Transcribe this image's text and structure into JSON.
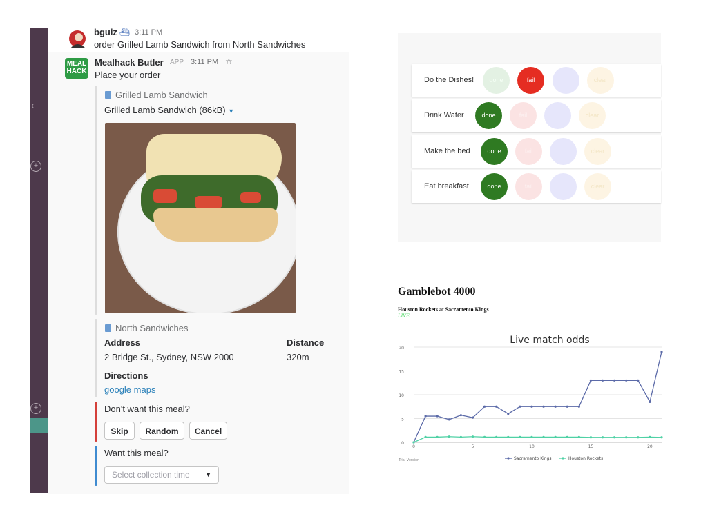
{
  "slack": {
    "user_message": {
      "username": "bguiz",
      "emoji": "⛴",
      "time": "3:11 PM",
      "text": "order Grilled Lamb Sandwich from North Sandwiches"
    },
    "bot_message": {
      "avatar_text_1": "MEAL",
      "avatar_text_2": "HACK",
      "username": "Mealhack Butler",
      "badge": "APP",
      "time": "3:11 PM",
      "text": "Place your order"
    },
    "meal_attachment": {
      "title": "Grilled Lamb Sandwich",
      "file_label": "Grilled Lamb Sandwich (86kB)"
    },
    "shop_attachment": {
      "title": "North Sandwiches",
      "address_label": "Address",
      "address_value": "2 Bridge St., Sydney, NSW 2000",
      "distance_label": "Distance",
      "distance_value": "320m",
      "directions_label": "Directions",
      "directions_link": "google maps"
    },
    "reject_attachment": {
      "question": "Don't want this meal?",
      "buttons": [
        "Skip",
        "Random",
        "Cancel"
      ]
    },
    "accept_attachment": {
      "question": "Want this meal?",
      "select_placeholder": "Select collection time"
    }
  },
  "habits": {
    "button_labels": {
      "done": "done",
      "fail": "fail",
      "skip": "",
      "clear": "clear"
    },
    "rows": [
      {
        "name": "Do the Dishes!",
        "state": "fail"
      },
      {
        "name": "Drink Water",
        "state": "done"
      },
      {
        "name": "Make the bed",
        "state": "done"
      },
      {
        "name": "Eat breakfast",
        "state": "done"
      }
    ]
  },
  "gamblebot": {
    "title": "Gamblebot 4000",
    "match": "Houston Rockets at Sacramento Kings",
    "status": "LIVE"
  },
  "chart_data": {
    "type": "line",
    "title": "Live match odds",
    "footnote": "Trial Version",
    "x": [
      0,
      1,
      2,
      3,
      4,
      5,
      6,
      7,
      8,
      9,
      10,
      11,
      12,
      13,
      14,
      15,
      16,
      17,
      18,
      19,
      20,
      21
    ],
    "xticks": [
      0,
      5,
      10,
      15,
      20
    ],
    "yticks": [
      0,
      5,
      10,
      15,
      20
    ],
    "ylim": [
      0,
      20
    ],
    "xlim": [
      0,
      21
    ],
    "grid": true,
    "legend": "bottom",
    "series": [
      {
        "name": "Sacramento Kings",
        "color": "#5b6aa8",
        "values": [
          0,
          5.5,
          5.5,
          4.8,
          5.7,
          5.2,
          7.5,
          7.5,
          6,
          7.5,
          7.5,
          7.5,
          7.5,
          7.5,
          7.5,
          13,
          13,
          13,
          13,
          13,
          8.5,
          19
        ]
      },
      {
        "name": "Houston Rockets",
        "color": "#4fd1a5",
        "values": [
          0,
          1.1,
          1.1,
          1.2,
          1.1,
          1.2,
          1.1,
          1.1,
          1.1,
          1.1,
          1.1,
          1.1,
          1.1,
          1.1,
          1.1,
          1.05,
          1.05,
          1.05,
          1.05,
          1.05,
          1.1,
          1.05
        ]
      }
    ]
  }
}
